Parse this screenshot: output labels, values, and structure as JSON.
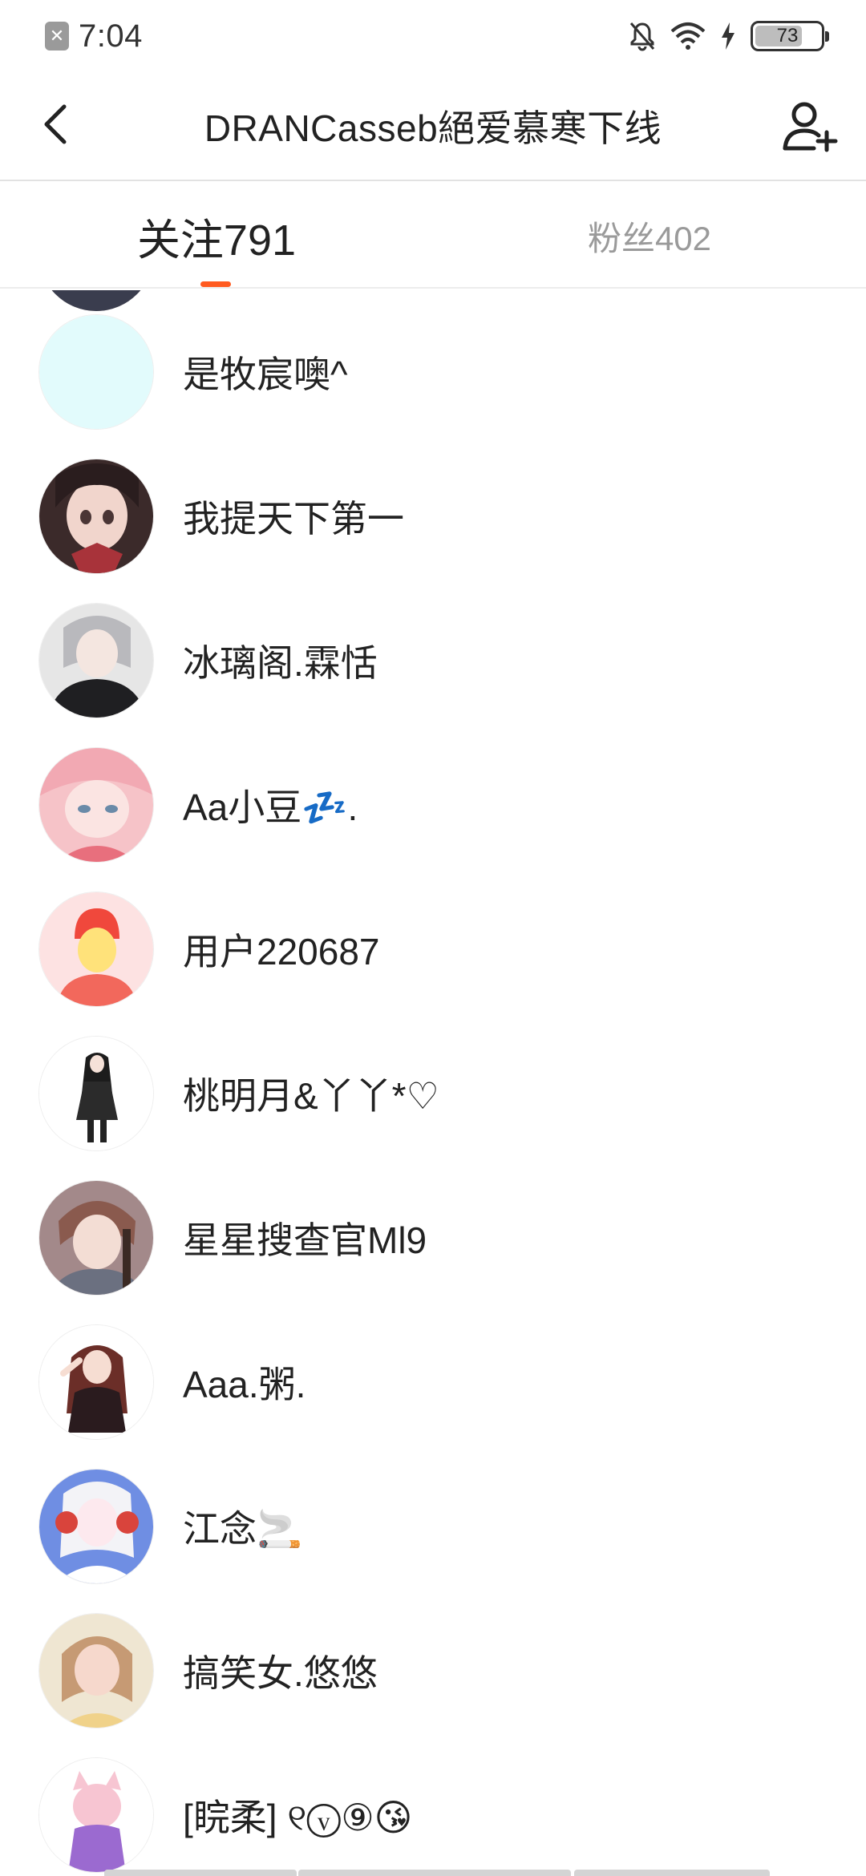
{
  "status_bar": {
    "time": "7:04",
    "battery": "73",
    "battery_level": 0.73,
    "icons": [
      "notification-x-icon",
      "bell-muted-icon",
      "wifi-icon",
      "charging-bolt-icon",
      "battery-icon"
    ]
  },
  "header": {
    "title": "DRANCasseb絕爱慕寒下线",
    "back_icon": "chevron-left-icon",
    "add_icon": "add-user-icon"
  },
  "tabs": {
    "following": {
      "label": "关注791",
      "active": true
    },
    "fans": {
      "label": "粉丝402",
      "active": false
    }
  },
  "colors": {
    "accent": "#ff5a1f",
    "text_primary": "#222222",
    "text_secondary": "#9a9a9a"
  },
  "users": [
    {
      "name": "是牧宸噢^"
    },
    {
      "name": "我提天下第一"
    },
    {
      "name": "冰璃阁.霖恬"
    },
    {
      "name": "Aa小豆💤."
    },
    {
      "name": "用户220687"
    },
    {
      "name": "桃明月&丫丫*♡"
    },
    {
      "name": "星星搜查官Ml9"
    },
    {
      "name": "Aaa.粥."
    },
    {
      "name": "江念🚬"
    },
    {
      "name": "搞笑女.悠悠"
    },
    {
      "name": "[睆柔] ୧ⓥ⑨😘"
    }
  ]
}
